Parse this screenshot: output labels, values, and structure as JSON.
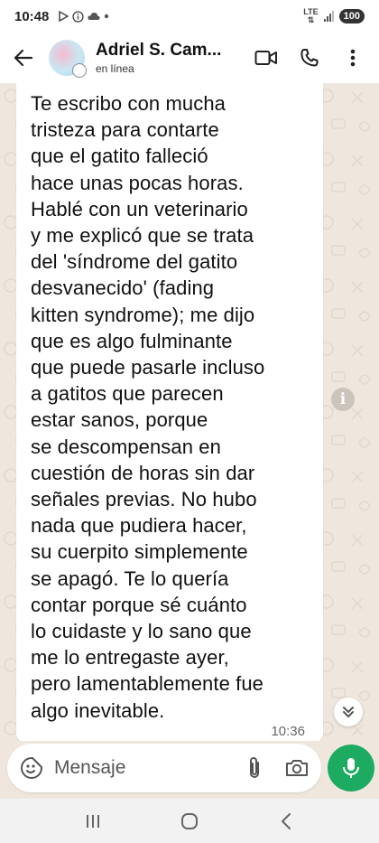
{
  "status_bar": {
    "time": "10:48",
    "network_label": "LTE",
    "battery": "100"
  },
  "header": {
    "contact_name": "Adriel S. Cam...",
    "contact_status": "en línea"
  },
  "message": {
    "text": "Te escribo con mucha\ntristeza para contarte\nque el gatito falleció\nhace unas pocas horas.\nHablé con un veterinario\ny me explicó que se trata\ndel 'síndrome del gatito\ndesvanecido' (fading\nkitten syndrome); me dijo\nque es algo fulminante\nque puede pasarle incluso\na gatitos que parecen\nestar sanos, porque\nse descompensan en\ncuestión de horas sin dar\nseñales previas. No hubo\nnada que pudiera hacer,\nsu cuerpito simplemente\nse apagó. Te lo quería\ncontar porque sé cuánto\nlo cuidaste y lo sano que\nme lo entregaste ayer,\npero lamentablemente fue\nalgo inevitable.",
    "time": "10:36"
  },
  "composer": {
    "placeholder": "Mensaje"
  },
  "icons": {
    "back": "back-arrow-icon",
    "video": "video-call-icon",
    "phone": "phone-call-icon",
    "menu": "more-vert-icon",
    "info": "info-icon",
    "scroll": "chevrons-down-icon",
    "emoji": "sticker-icon",
    "attach": "paperclip-icon",
    "camera": "camera-icon",
    "mic": "mic-icon"
  },
  "colors": {
    "accent": "#1daa61",
    "chat_background": "#efe7de",
    "bubble": "#ffffff"
  }
}
